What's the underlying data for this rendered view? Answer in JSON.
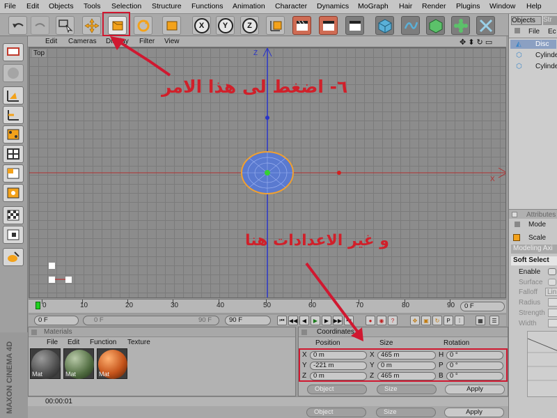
{
  "menu": [
    "File",
    "Edit",
    "Objects",
    "Tools",
    "Selection",
    "Structure",
    "Functions",
    "Animation",
    "Character",
    "Dynamics",
    "MoGraph",
    "Hair",
    "Render",
    "Plugins",
    "Window",
    "Help"
  ],
  "viewport": {
    "menu": [
      "Edit",
      "Cameras",
      "Display",
      "Filter",
      "View"
    ],
    "label": "Top",
    "axis_z": "Z",
    "axis_x": "X"
  },
  "annotations": {
    "step6": "٦- اضغط لى هذا الامر",
    "change_settings": "و غير الاعدادات هنا"
  },
  "timeline": {
    "ticks": [
      "0",
      "10",
      "20",
      "30",
      "40",
      "50",
      "60",
      "70",
      "80",
      "90"
    ],
    "current_frame": "0 F",
    "start_field": "0 F",
    "range_start": "0 F",
    "range_end": "90 F",
    "end_field": "90 F"
  },
  "materials": {
    "title": "Materials",
    "menu": [
      "File",
      "Edit",
      "Function",
      "Texture"
    ],
    "items": [
      {
        "label": "Mat",
        "color": "#4a4a4a"
      },
      {
        "label": "Mat",
        "color": "#4f6b3f"
      },
      {
        "label": "Mat",
        "color": "#c5541b"
      }
    ]
  },
  "coordinates": {
    "title": "Coordinates",
    "headers": [
      "Position",
      "Size",
      "Rotation"
    ],
    "rows": [
      {
        "axis": "X",
        "pos": "0 m",
        "saxis": "X",
        "size": "465 m",
        "raxis": "H",
        "rot": "0 °"
      },
      {
        "axis": "Y",
        "pos": "-221 m",
        "saxis": "Y",
        "size": "0 m",
        "raxis": "P",
        "rot": "0 °"
      },
      {
        "axis": "Z",
        "pos": "0 m",
        "saxis": "Z",
        "size": "465 m",
        "raxis": "B",
        "rot": "0 °"
      }
    ],
    "mode_dropdown": "Object",
    "size_dropdown": "Size",
    "apply": "Apply",
    "mode_dropdown2": "Object",
    "size_dropdown2": "Size",
    "apply2": "Apply"
  },
  "status": {
    "time": "00:00:01"
  },
  "objects_panel": {
    "tabs": [
      "Objects",
      "Str"
    ],
    "menu": [
      "File",
      "Ec"
    ],
    "items": [
      "Disc",
      "Cylinde",
      "Cylinde"
    ]
  },
  "attributes_panel": {
    "title": "Attributes",
    "mode": "Mode",
    "tool": "Scale",
    "modeling_axis": "Modeling Axi",
    "soft_select": "Soft Select",
    "fields": [
      "Enable",
      "Surface",
      "Falloff",
      "Radius",
      "Strength",
      "Width"
    ],
    "falloff_value": "Lin"
  },
  "logo": {
    "text": "MAXON CINEMA 4D"
  }
}
